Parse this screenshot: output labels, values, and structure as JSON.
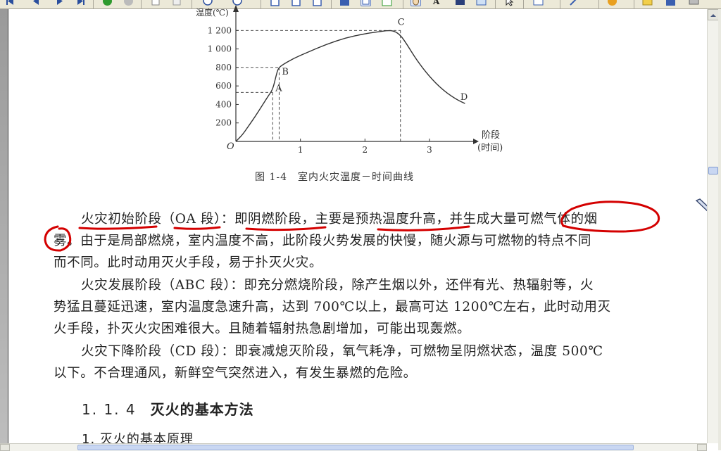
{
  "chart_data": {
    "type": "line",
    "y_axis_label": "温度(℃)",
    "x_axis_label": [
      "阶段",
      "(时间)"
    ],
    "origin_label": "O",
    "y_ticks": [
      200,
      400,
      600,
      800,
      1000,
      1200
    ],
    "y_tick_labels": [
      "200",
      "400",
      "600",
      "800",
      "1 000",
      "1 200"
    ],
    "x_ticks": [
      1,
      2,
      3
    ],
    "x_tick_labels": [
      "1",
      "2",
      "3"
    ],
    "xlim": [
      0,
      3.6
    ],
    "ylim": [
      0,
      1400
    ],
    "curve": [
      [
        0,
        0
      ],
      [
        0.1,
        70
      ],
      [
        0.2,
        170
      ],
      [
        0.3,
        270
      ],
      [
        0.4,
        380
      ],
      [
        0.5,
        490
      ],
      [
        0.57,
        560
      ],
      [
        0.62,
        700
      ],
      [
        0.65,
        780
      ],
      [
        0.7,
        820
      ],
      [
        0.9,
        900
      ],
      [
        1.1,
        960
      ],
      [
        1.4,
        1050
      ],
      [
        1.7,
        1120
      ],
      [
        2.0,
        1165
      ],
      [
        2.2,
        1185
      ],
      [
        2.35,
        1200
      ],
      [
        2.45,
        1195
      ],
      [
        2.55,
        1150
      ],
      [
        2.65,
        1050
      ],
      [
        2.8,
        880
      ],
      [
        3.0,
        700
      ],
      [
        3.2,
        560
      ],
      [
        3.4,
        460
      ],
      [
        3.55,
        410
      ]
    ],
    "points": [
      {
        "label": "A",
        "x": 0.57,
        "y": 530
      },
      {
        "label": "B",
        "x": 0.67,
        "y": 800
      },
      {
        "label": "C",
        "x": 2.55,
        "y": 1200
      },
      {
        "label": "D",
        "x": 3.5,
        "y": 420
      }
    ],
    "guides": [
      {
        "x": 0.57,
        "y": 530
      },
      {
        "x": 0.67,
        "y": 800
      },
      {
        "x": 2.55,
        "y": 1200
      }
    ]
  },
  "figure": {
    "caption": "图 1-4　室内火灾温度－时间曲线"
  },
  "paragraphs": {
    "p1_line1": "火灾初始阶段（OA 段）：即阴燃阶段，主要是预热温度升高，并生成大量可燃气体的烟",
    "p1_line2": "雾。由于是局部燃烧，室内温度不高，此阶段火势发展的快慢，随火源与可燃物的特点不同",
    "p1_line3": "而不同。此时动用灭火手段，易于扑灭火灾。",
    "p2_line1": "火灾发展阶段（ABC 段）：即充分燃烧阶段，除产生烟以外，还伴有光、热辐射等，火",
    "p2_line2": "势猛且蔓延迅速，室内温度急速升高，达到 700℃以上，最高可达 1200℃左右，此时动用灭",
    "p2_line3": "火手段，扑灭火灾困难很大。且随着辐射热急剧增加，可能出现轰燃。",
    "p3_line1": "火灾下降阶段（CD 段）：即衰减熄灭阶段，氧气耗净，可燃物呈阴燃状态，温度 500℃",
    "p3_line2": "以下。不合理通风，新鲜空气突然进入，有发生暴燃的危险。"
  },
  "section": {
    "number": "1. 1. 4",
    "title": "灭火的基本方法"
  },
  "subsection": {
    "text": "1. 灭火的基本原理"
  },
  "annotation": {
    "color": "#d40000"
  },
  "toolbar": {
    "icons": [
      "first-page-icon",
      "prev-page-icon",
      "next-page-icon",
      "last-page-icon",
      "go-icon",
      "stop-icon",
      "copy-icon",
      "paste-icon",
      "zoom-out-icon",
      "zoom-in-icon",
      "single-page-icon",
      "facing-pages-icon",
      "continuous-icon",
      "save-icon",
      "text-select-icon",
      "edit-icon",
      "hand-icon",
      "text-tool-icon",
      "image-icon",
      "snapshot-icon",
      "pointer-icon",
      "note-icon",
      "magic-icon",
      "help-icon",
      "folder-icon",
      "save-file-icon",
      "print-icon"
    ]
  }
}
